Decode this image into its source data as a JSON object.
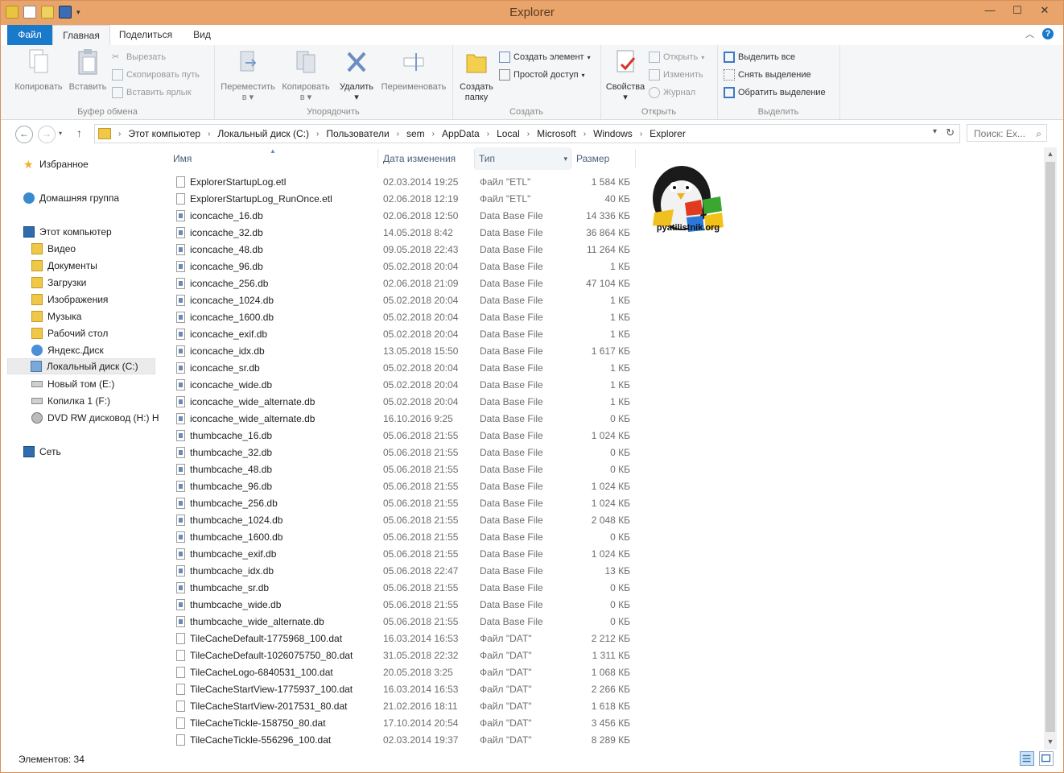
{
  "window": {
    "title": "Explorer"
  },
  "tabs": {
    "file": "Файл",
    "home": "Главная",
    "share": "Поделиться",
    "view": "Вид"
  },
  "ribbon": {
    "clipboard": {
      "title": "Буфер обмена",
      "copy": "Копировать",
      "paste": "Вставить",
      "cut": "Вырезать",
      "copy_path": "Скопировать путь",
      "paste_shortcut": "Вставить ярлык"
    },
    "organize": {
      "title": "Упорядочить",
      "move_to_1": "Переместить",
      "move_to_2": "в",
      "copy_to_1": "Копировать",
      "copy_to_2": "в",
      "delete": "Удалить",
      "rename": "Переименовать"
    },
    "create": {
      "title": "Создать",
      "new_folder_1": "Создать",
      "new_folder_2": "папку",
      "new_item": "Создать элемент",
      "easy_access": "Простой доступ"
    },
    "open": {
      "title": "Открыть",
      "properties": "Свойства",
      "open": "Открыть",
      "edit": "Изменить",
      "history": "Журнал"
    },
    "select": {
      "title": "Выделить",
      "select_all": "Выделить все",
      "select_none": "Снять выделение",
      "invert": "Обратить выделение"
    }
  },
  "address": {
    "crumbs": [
      "Этот компьютер",
      "Локальный диск (C:)",
      "Пользователи",
      "sem",
      "AppData",
      "Local",
      "Microsoft",
      "Windows",
      "Explorer"
    ],
    "search_placeholder": "Поиск: Ex..."
  },
  "nav": {
    "favorites": "Избранное",
    "homegroup": "Домашняя группа",
    "this_pc": "Этот компьютер",
    "video": "Видео",
    "documents": "Документы",
    "downloads": "Загрузки",
    "pictures": "Изображения",
    "music": "Музыка",
    "desktop": "Рабочий стол",
    "yandex": "Яндекс.Диск",
    "local_c": "Локальный диск (C:)",
    "new_e": "Новый том (E:)",
    "copy_f": "Копилка 1 (F:)",
    "dvd_h": "DVD RW дисковод (H:) Н",
    "network": "Сеть"
  },
  "columns": {
    "name": "Имя",
    "date": "Дата изменения",
    "type": "Тип",
    "size": "Размер"
  },
  "files": [
    {
      "name": "ExplorerStartupLog.etl",
      "date": "02.03.2014 19:25",
      "type": "Файл \"ETL\"",
      "size": "1 584 КБ",
      "kind": "file"
    },
    {
      "name": "ExplorerStartupLog_RunOnce.etl",
      "date": "02.06.2018 12:19",
      "type": "Файл \"ETL\"",
      "size": "40 КБ",
      "kind": "file"
    },
    {
      "name": "iconcache_16.db",
      "date": "02.06.2018 12:50",
      "type": "Data Base File",
      "size": "14 336 КБ",
      "kind": "db"
    },
    {
      "name": "iconcache_32.db",
      "date": "14.05.2018 8:42",
      "type": "Data Base File",
      "size": "36 864 КБ",
      "kind": "db"
    },
    {
      "name": "iconcache_48.db",
      "date": "09.05.2018 22:43",
      "type": "Data Base File",
      "size": "11 264 КБ",
      "kind": "db"
    },
    {
      "name": "iconcache_96.db",
      "date": "05.02.2018 20:04",
      "type": "Data Base File",
      "size": "1 КБ",
      "kind": "db"
    },
    {
      "name": "iconcache_256.db",
      "date": "02.06.2018 21:09",
      "type": "Data Base File",
      "size": "47 104 КБ",
      "kind": "db"
    },
    {
      "name": "iconcache_1024.db",
      "date": "05.02.2018 20:04",
      "type": "Data Base File",
      "size": "1 КБ",
      "kind": "db"
    },
    {
      "name": "iconcache_1600.db",
      "date": "05.02.2018 20:04",
      "type": "Data Base File",
      "size": "1 КБ",
      "kind": "db"
    },
    {
      "name": "iconcache_exif.db",
      "date": "05.02.2018 20:04",
      "type": "Data Base File",
      "size": "1 КБ",
      "kind": "db"
    },
    {
      "name": "iconcache_idx.db",
      "date": "13.05.2018 15:50",
      "type": "Data Base File",
      "size": "1 617 КБ",
      "kind": "db"
    },
    {
      "name": "iconcache_sr.db",
      "date": "05.02.2018 20:04",
      "type": "Data Base File",
      "size": "1 КБ",
      "kind": "db"
    },
    {
      "name": "iconcache_wide.db",
      "date": "05.02.2018 20:04",
      "type": "Data Base File",
      "size": "1 КБ",
      "kind": "db"
    },
    {
      "name": "iconcache_wide_alternate.db",
      "date": "05.02.2018 20:04",
      "type": "Data Base File",
      "size": "1 КБ",
      "kind": "db"
    },
    {
      "name": "iconcache_wide_alternate.db",
      "date": "16.10.2016 9:25",
      "type": "Data Base File",
      "size": "0 КБ",
      "kind": "db"
    },
    {
      "name": "thumbcache_16.db",
      "date": "05.06.2018 21:55",
      "type": "Data Base File",
      "size": "1 024 КБ",
      "kind": "db"
    },
    {
      "name": "thumbcache_32.db",
      "date": "05.06.2018 21:55",
      "type": "Data Base File",
      "size": "0 КБ",
      "kind": "db"
    },
    {
      "name": "thumbcache_48.db",
      "date": "05.06.2018 21:55",
      "type": "Data Base File",
      "size": "0 КБ",
      "kind": "db"
    },
    {
      "name": "thumbcache_96.db",
      "date": "05.06.2018 21:55",
      "type": "Data Base File",
      "size": "1 024 КБ",
      "kind": "db"
    },
    {
      "name": "thumbcache_256.db",
      "date": "05.06.2018 21:55",
      "type": "Data Base File",
      "size": "1 024 КБ",
      "kind": "db"
    },
    {
      "name": "thumbcache_1024.db",
      "date": "05.06.2018 21:55",
      "type": "Data Base File",
      "size": "2 048 КБ",
      "kind": "db"
    },
    {
      "name": "thumbcache_1600.db",
      "date": "05.06.2018 21:55",
      "type": "Data Base File",
      "size": "0 КБ",
      "kind": "db"
    },
    {
      "name": "thumbcache_exif.db",
      "date": "05.06.2018 21:55",
      "type": "Data Base File",
      "size": "1 024 КБ",
      "kind": "db"
    },
    {
      "name": "thumbcache_idx.db",
      "date": "05.06.2018 22:47",
      "type": "Data Base File",
      "size": "13 КБ",
      "kind": "db"
    },
    {
      "name": "thumbcache_sr.db",
      "date": "05.06.2018 21:55",
      "type": "Data Base File",
      "size": "0 КБ",
      "kind": "db"
    },
    {
      "name": "thumbcache_wide.db",
      "date": "05.06.2018 21:55",
      "type": "Data Base File",
      "size": "0 КБ",
      "kind": "db"
    },
    {
      "name": "thumbcache_wide_alternate.db",
      "date": "05.06.2018 21:55",
      "type": "Data Base File",
      "size": "0 КБ",
      "kind": "db"
    },
    {
      "name": "TileCacheDefault-1775968_100.dat",
      "date": "16.03.2014 16:53",
      "type": "Файл \"DAT\"",
      "size": "2 212 КБ",
      "kind": "file"
    },
    {
      "name": "TileCacheDefault-1026075750_80.dat",
      "date": "31.05.2018 22:32",
      "type": "Файл \"DAT\"",
      "size": "1 311 КБ",
      "kind": "file"
    },
    {
      "name": "TileCacheLogo-6840531_100.dat",
      "date": "20.05.2018 3:25",
      "type": "Файл \"DAT\"",
      "size": "1 068 КБ",
      "kind": "file"
    },
    {
      "name": "TileCacheStartView-1775937_100.dat",
      "date": "16.03.2014 16:53",
      "type": "Файл \"DAT\"",
      "size": "2 266 КБ",
      "kind": "file"
    },
    {
      "name": "TileCacheStartView-2017531_80.dat",
      "date": "21.02.2016 18:11",
      "type": "Файл \"DAT\"",
      "size": "1 618 КБ",
      "kind": "file"
    },
    {
      "name": "TileCacheTickle-158750_80.dat",
      "date": "17.10.2014 20:54",
      "type": "Файл \"DAT\"",
      "size": "3 456 КБ",
      "kind": "file"
    },
    {
      "name": "TileCacheTickle-556296_100.dat",
      "date": "02.03.2014 19:37",
      "type": "Файл \"DAT\"",
      "size": "8 289 КБ",
      "kind": "file"
    }
  ],
  "status": {
    "items_count": "Элементов: 34"
  },
  "watermark": {
    "text": "pyatilistnik.org"
  },
  "colors": {
    "accent": "#1979ca",
    "titlebar": "#e8a46b"
  }
}
